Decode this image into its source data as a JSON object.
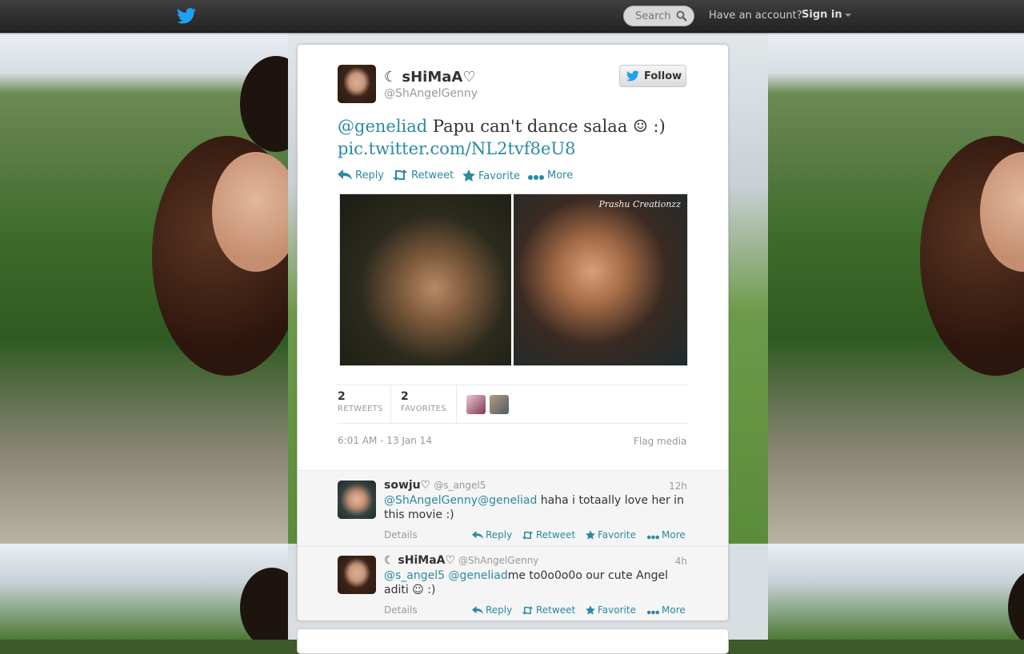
{
  "topbar": {
    "search_placeholder": "Search",
    "have_account": "Have an account?",
    "sign_in": "Sign in"
  },
  "tweet": {
    "display_name": "☾ sHiMaA♡",
    "handle": "@ShAngelGenny",
    "follow_label": "Follow",
    "mention": "@geneliad",
    "text": " Papu can't dance salaa ☺ :)",
    "link": "pic.twitter.com/NL2tvf8eU8",
    "actions": {
      "reply": "Reply",
      "retweet": "Retweet",
      "favorite": "Favorite",
      "more": "More"
    },
    "media_watermark": "Prashu Creationzz",
    "stats": {
      "retweets_count": "2",
      "retweets_label": "RETWEETS",
      "favorites_count": "2",
      "favorites_label": "FAVORITES"
    },
    "timestamp": "6:01 AM - 13 Jan 14",
    "flag_media": "Flag media"
  },
  "replies": [
    {
      "display_name": "sowju♡",
      "handle": "@s_angel5",
      "time": "12h",
      "mentions": "@ShAngelGenny@geneliad",
      "text": " haha i totaally love her in this movie :)",
      "details": "Details",
      "reply": "Reply",
      "retweet": "Retweet",
      "favorite": "Favorite",
      "more": "More"
    },
    {
      "display_name": "☾ sHiMaA♡",
      "handle": "@ShAngelGenny",
      "time": "4h",
      "mentions": "@s_angel5 @geneliad",
      "text": "me to0o0o0o our cute Angel aditi ☺ :)",
      "details": "Details",
      "reply": "Reply",
      "retweet": "Retweet",
      "favorite": "Favorite",
      "more": "More"
    }
  ],
  "colors": {
    "link": "#2a8aa0",
    "twitter_blue": "#1da1f2",
    "topbar": "#2b2b2b"
  }
}
